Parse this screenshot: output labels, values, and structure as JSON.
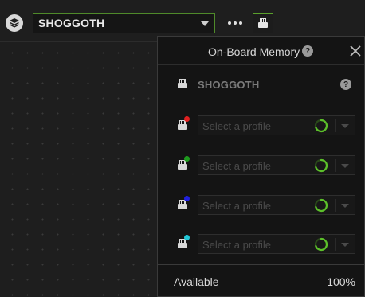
{
  "toolbar": {
    "device_name": "SHOGGOTH",
    "stack_icon": "layers-icon",
    "more_icon": "ellipsis-icon",
    "memory_icon": "memory-card-icon",
    "accent_color": "#5aa02c"
  },
  "panel": {
    "title": "On-Board Memory",
    "help_glyph": "?",
    "close_icon": "close-icon",
    "device_name": "SHOGGOTH",
    "slots": [
      {
        "placeholder": "Select a profile",
        "color": "#e02020"
      },
      {
        "placeholder": "Select a profile",
        "color": "#1e9a1e"
      },
      {
        "placeholder": "Select a profile",
        "color": "#2020e0"
      },
      {
        "placeholder": "Select a profile",
        "color": "#22c8d8"
      }
    ],
    "footer": {
      "label": "Available",
      "value": "100%"
    }
  }
}
